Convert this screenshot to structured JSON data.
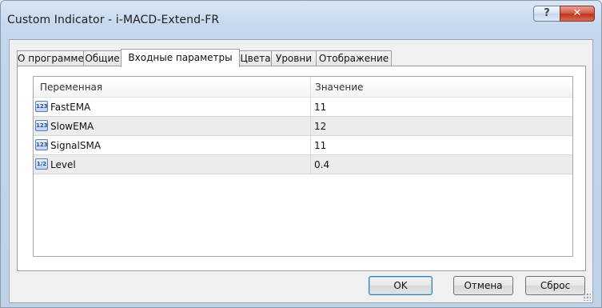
{
  "window": {
    "title": "Custom Indicator - i-MACD-Extend-FR",
    "help_label": "?",
    "close_label": "✕"
  },
  "tabs": [
    {
      "label": "О программе",
      "active": false
    },
    {
      "label": "Общие",
      "active": false
    },
    {
      "label": "Входные параметры",
      "active": true
    },
    {
      "label": "Цвета",
      "active": false
    },
    {
      "label": "Уровни",
      "active": false
    },
    {
      "label": "Отображение",
      "active": false
    }
  ],
  "grid": {
    "columns": [
      "Переменная",
      "Значение"
    ],
    "rows": [
      {
        "icon": "integer-type-icon",
        "icon_text": "123",
        "name": "FastEMA",
        "value": "11"
      },
      {
        "icon": "integer-type-icon",
        "icon_text": "123",
        "name": "SlowEMA",
        "value": "12"
      },
      {
        "icon": "integer-type-icon",
        "icon_text": "123",
        "name": "SignalSMA",
        "value": "11"
      },
      {
        "icon": "double-type-icon",
        "icon_text": "1/2",
        "name": "Level",
        "value": "0.4"
      }
    ]
  },
  "buttons": {
    "ok": "OK",
    "cancel": "Отмена",
    "reset": "Сброс"
  }
}
